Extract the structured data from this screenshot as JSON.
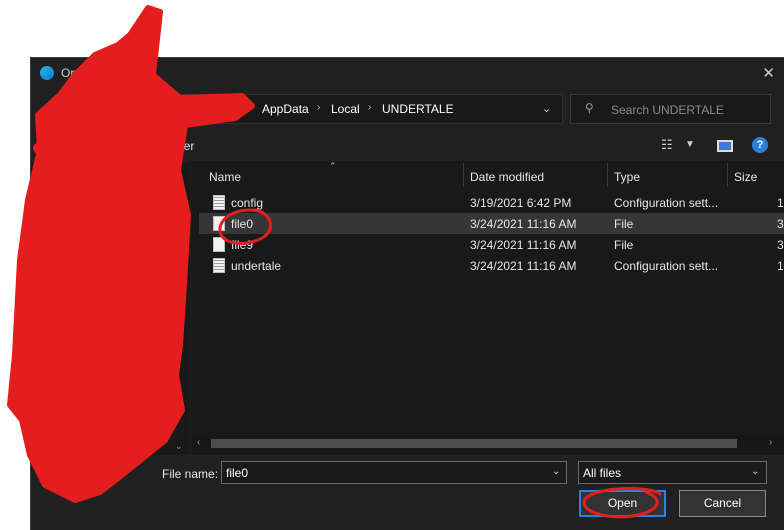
{
  "window": {
    "title": "Open"
  },
  "address": {
    "crumbs": [
      "AppData",
      "Local",
      "UNDERTALE"
    ],
    "search_placeholder": "Search UNDERTALE"
  },
  "toolbar": {
    "partial_label": "der"
  },
  "columns": [
    "Name",
    "Date modified",
    "Type",
    "Size"
  ],
  "files": [
    {
      "name": "config",
      "date": "3/19/2021 6:42 PM",
      "type": "Configuration sett...",
      "size": "1",
      "icon": "config-file-icon"
    },
    {
      "name": "file0",
      "date": "3/24/2021 11:16 AM",
      "type": "File",
      "size": "3",
      "icon": "file-icon",
      "selected": true
    },
    {
      "name": "file9",
      "date": "3/24/2021 11:16 AM",
      "type": "File",
      "size": "3",
      "icon": "file-icon"
    },
    {
      "name": "undertale",
      "date": "3/24/2021 11:16 AM",
      "type": "Configuration sett...",
      "size": "1",
      "icon": "config-file-icon"
    }
  ],
  "footer": {
    "file_name_label": "File name:",
    "file_name_value": "file0",
    "file_type": "All files",
    "open_label": "Open",
    "cancel_label": "Cancel"
  },
  "colors": {
    "dialog_bg": "#202020",
    "list_bg": "#191919",
    "selected_row": "#363636",
    "accent": "#2f7fe0",
    "scribble": "#e41e1e"
  }
}
